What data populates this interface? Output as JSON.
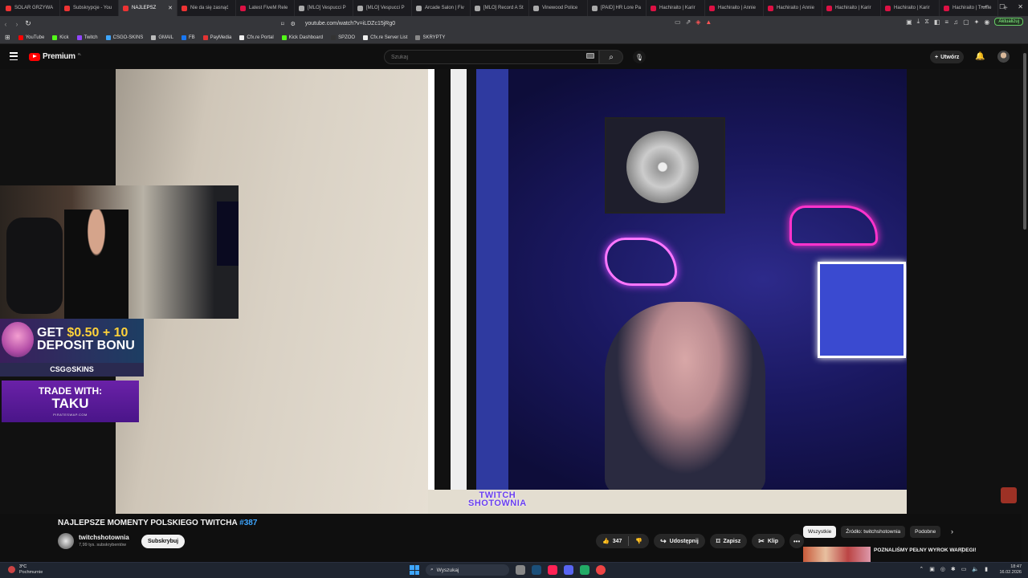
{
  "browser": {
    "tabs": [
      {
        "label": "SOLAR GRZYWA",
        "icon": "youtube-icon",
        "active": false
      },
      {
        "label": "Subskrypcje - You",
        "icon": "youtube-icon",
        "active": false
      },
      {
        "label": "NAJLEPSZ",
        "icon": "youtube-icon",
        "active": true
      },
      {
        "label": "Nie da się zasnąć",
        "icon": "youtube-icon",
        "active": false
      },
      {
        "label": "Latest FiveM Rele",
        "icon": "fivem-icon",
        "active": false
      },
      {
        "label": "[MLO] Vespucci P",
        "icon": "doc-icon",
        "active": false
      },
      {
        "label": "[MLO] Vespucci P",
        "icon": "doc-icon",
        "active": false
      },
      {
        "label": "Arcade Salon | Fiv",
        "icon": "doc-icon",
        "active": false
      },
      {
        "label": "[MLO] Record A St",
        "icon": "doc-icon",
        "active": false
      },
      {
        "label": "Vinewood Police",
        "icon": "doc-icon",
        "active": false
      },
      {
        "label": "[PAID] HR Lore Pa",
        "icon": "doc-icon",
        "active": false
      },
      {
        "label": "Hachiraito | Karir",
        "icon": "fivem-icon",
        "active": false
      },
      {
        "label": "Hachiraito | Annie",
        "icon": "fivem-icon",
        "active": false
      },
      {
        "label": "Hachiraito | Annie",
        "icon": "fivem-icon",
        "active": false
      },
      {
        "label": "Hachiraito | Karir",
        "icon": "fivem-icon",
        "active": false
      },
      {
        "label": "Hachiraito | Karir",
        "icon": "fivem-icon",
        "active": false
      },
      {
        "label": "Hachiraito | Truffle",
        "icon": "fivem-icon",
        "active": false
      }
    ],
    "new_tab": "+",
    "url": "youtube.com/watch?v=iLDZc15jRg0",
    "update_label": "Aktualizuj",
    "bookmarks": [
      {
        "label": "YouTube",
        "color": "#ff0000"
      },
      {
        "label": "Kick",
        "color": "#53fc18"
      },
      {
        "label": "Twitch",
        "color": "#9146ff"
      },
      {
        "label": "CSGO-SKINS",
        "color": "#3ea6ff"
      },
      {
        "label": "GMAIL",
        "color": "#bbbbbb"
      },
      {
        "label": "FB",
        "color": "#1877f2"
      },
      {
        "label": "PayMedia",
        "color": "#e33333"
      },
      {
        "label": "Cfx.re Portal",
        "color": "#eeeeee"
      },
      {
        "label": "Kick Dashboard",
        "color": "#53fc18"
      },
      {
        "label": "SPZOO",
        "color": "#333333"
      },
      {
        "label": "Cfx.re Server List",
        "color": "#eeeeee"
      },
      {
        "label": "SKRYPTY",
        "color": "#888888"
      }
    ]
  },
  "youtube": {
    "logo_text": "Premium",
    "logo_region": "PL",
    "search_placeholder": "Szukaj",
    "create_label": "Utwórz"
  },
  "video": {
    "overlay_line1": "TWITCH",
    "overlay_line2": "SHOTOWNIA",
    "ad_line1_prefix": "GET ",
    "ad_line1_highlight": "$0.50 + 10",
    "ad_line2": "DEPOSIT BONU",
    "ad_brand": "CSG⊙SKINS",
    "trade_line1": "TRADE WITH:",
    "trade_line2": "TAKU",
    "trade_line3": "PIRATESWAP.COM"
  },
  "meta": {
    "title": "NAJLEPSZE MOMENTY POLSKIEGO TWITCHA",
    "title_hashtag": "#387",
    "channel_name": "twitchshotownia",
    "channel_subs": "7,99 tys. subskrybentów",
    "subscribe_label": "Subskrybuj",
    "like_count": "347",
    "share_label": "Udostępnij",
    "save_label": "Zapisz",
    "clip_label": "Klip",
    "more_label": "•••"
  },
  "sidebar": {
    "chips": [
      "Wszystkie",
      "Źródło: twitchshotownia",
      "Podobne"
    ],
    "reco_title": "POZNALIŚMY PEŁNY WYROK WARDEGI!"
  },
  "taskbar": {
    "temperature": "3°C",
    "weather_desc": "Pochmurnie",
    "search_label": "Wyszukaj",
    "time": "18:47",
    "date": "16.02.2026"
  }
}
